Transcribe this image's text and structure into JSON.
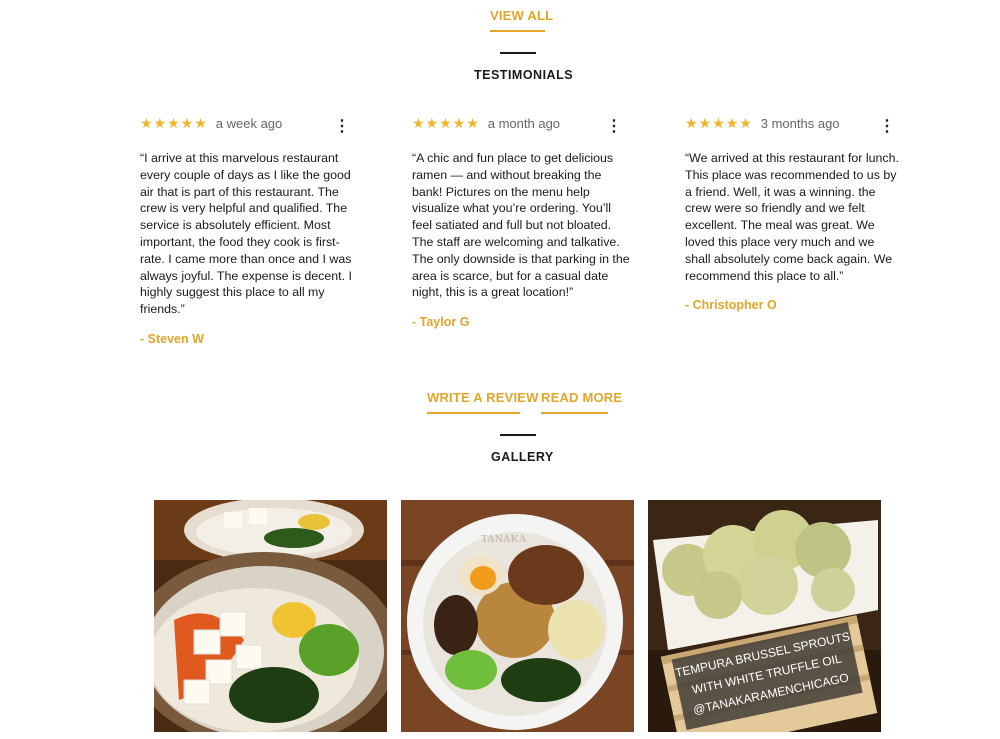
{
  "links": {
    "view_all": "VIEW ALL",
    "write_review": "WRITE A REVIEW",
    "read_more": "READ MORE"
  },
  "testimonials": {
    "heading": "TESTIMONIALS",
    "reviews": [
      {
        "stars": "★★★★★",
        "rating": 5,
        "time_ago": "a week ago",
        "text": "“I arrive at this marvelous restaurant every couple of days as I like the good air that is part of this restaurant. The crew is very helpful and qualified. The service is absolutely efficient. Most important, the food they cook is first-rate. I came more than once and I was always joyful. The expense is decent. I highly suggest this place to all my friends.”",
        "author": "- Steven W"
      },
      {
        "stars": "★★★★★",
        "rating": 5,
        "time_ago": "a month ago",
        "text": "“A chic and fun place to get delicious ramen — and without breaking the bank! Pictures on the menu help visualize what you’re ordering. You’ll feel satiated and full but not bloated. The staff are welcoming and talkative. The only downside is that parking in the area is scarce, but for a casual date night, this is a great location!”",
        "author": "- Taylor G"
      },
      {
        "stars": "★★★★★",
        "rating": 5,
        "time_ago": "3 months ago",
        "text": "“We arrived at this restaurant for lunch. This place was recommended to us by a friend. Well, it was a winning. the crew were so friendly and we felt excellent. The meal was great. We loved this place very much and we shall absolutely come back again. We recommend this place to all.”",
        "author": "- Christopher O"
      }
    ]
  },
  "gallery": {
    "heading": "GALLERY",
    "photo_caption_lines": [
      "TEMPURA BRUSSEL SPROUTS",
      "WITH WHITE TRUFFLE OIL",
      "@TANAKARAMENCHICAGO"
    ]
  },
  "icons": {
    "kebab": "more-options-icon",
    "star": "star-icon"
  },
  "colors": {
    "accent": "#e0a62b",
    "star": "#f0b429",
    "text": "#1a1a1a"
  }
}
